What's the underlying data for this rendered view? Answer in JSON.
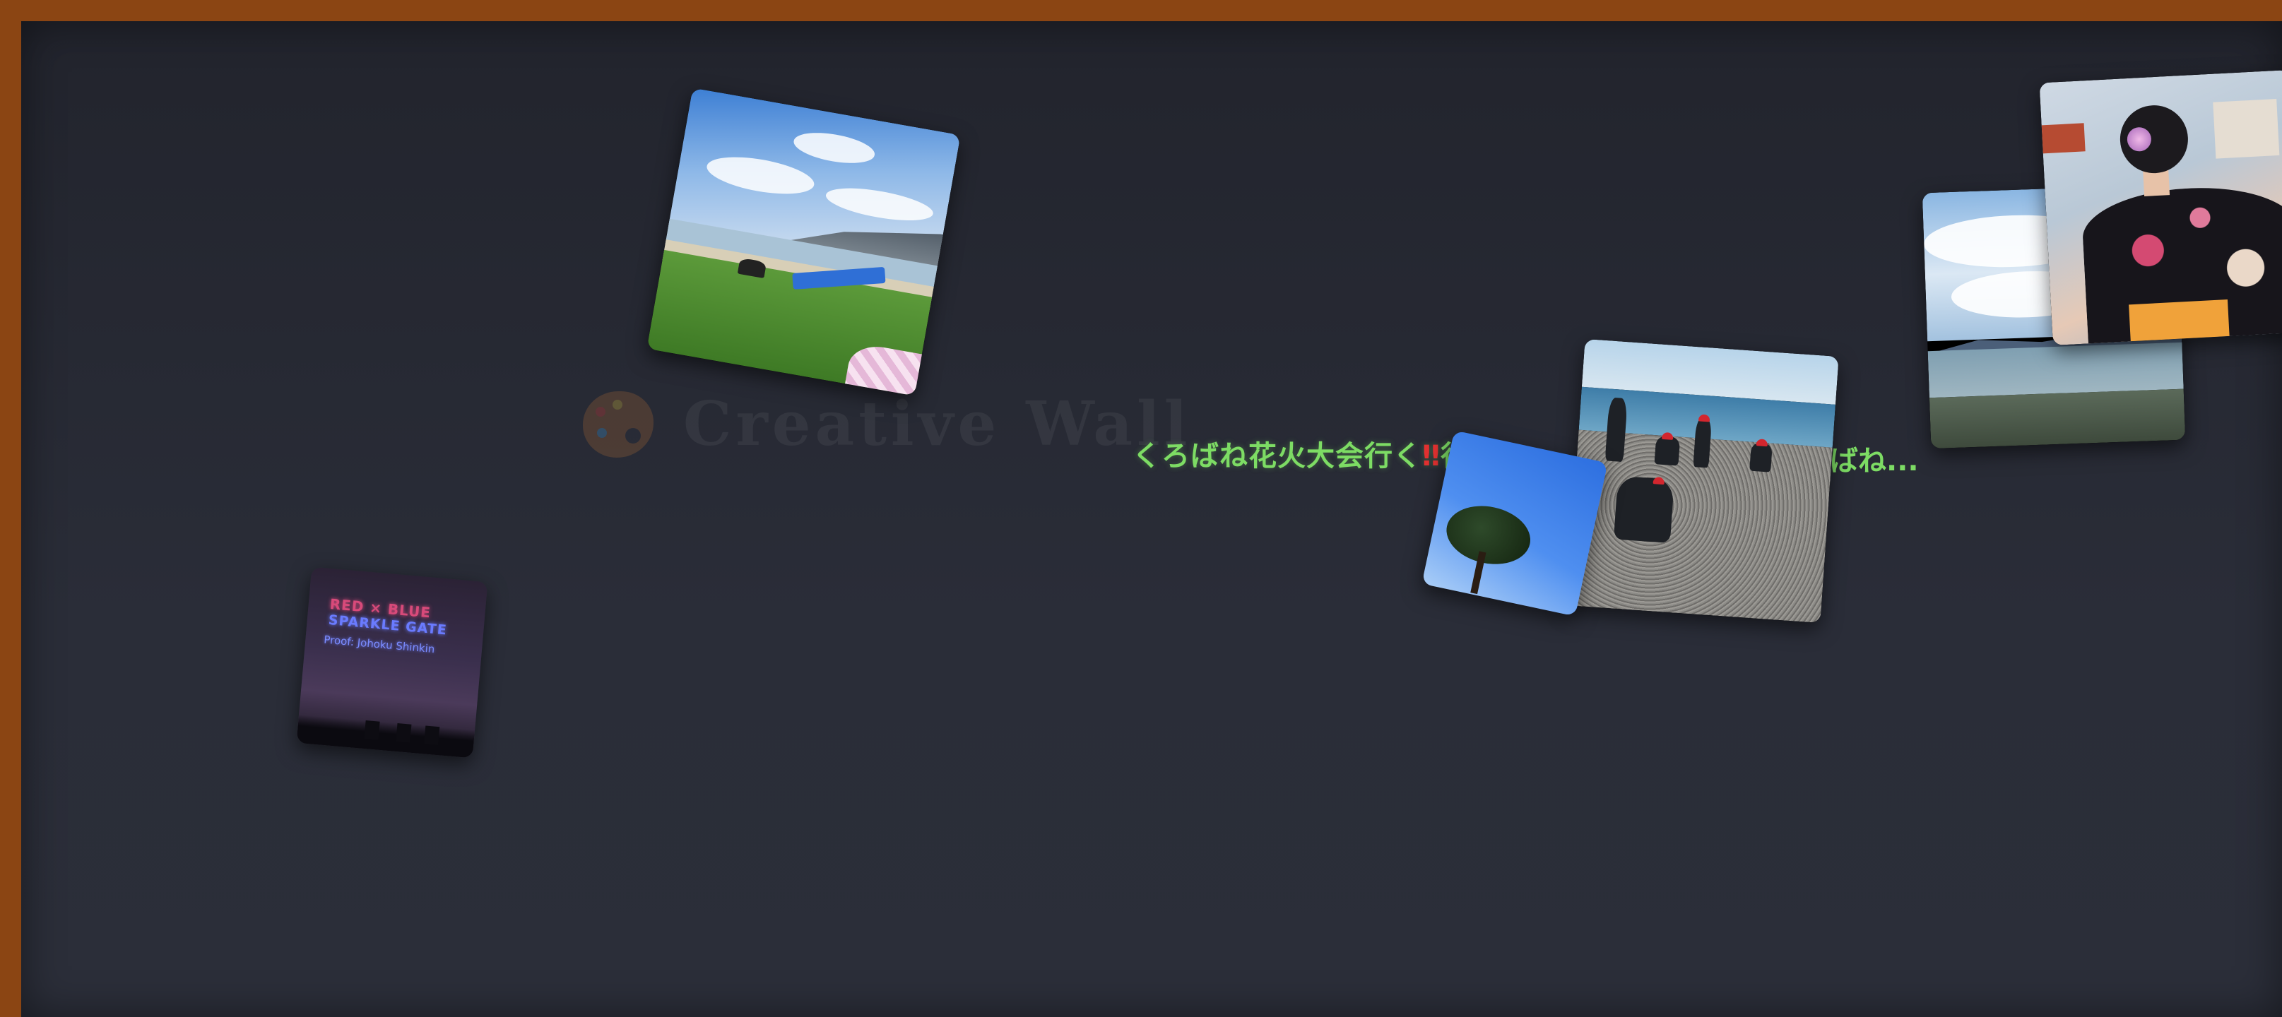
{
  "wall": {
    "title": "Creative Wall",
    "palette_icon": "palette-icon"
  },
  "caption": {
    "text_start": "くろばね花火大会行く",
    "exclaim": "‼",
    "text_mid": "行き",
    "text_end": "ばね..."
  },
  "photos": [
    {
      "subject": "seaside-picnic-photo"
    },
    {
      "subject": "drone-show-photo",
      "lines": [
        "RED × BLUE",
        "SPARKLE GATE",
        "Proof: Johoku Shinkin"
      ]
    },
    {
      "subject": "beach-group-photo"
    },
    {
      "subject": "blue-sky-tree-photo"
    },
    {
      "subject": "lake-view-photo"
    },
    {
      "subject": "yukata-photo"
    }
  ],
  "colors": {
    "frame": "#8b4513",
    "wall_bg": "#2a2d38",
    "caption": "#7ddc64",
    "exclaim": "#e23131"
  }
}
